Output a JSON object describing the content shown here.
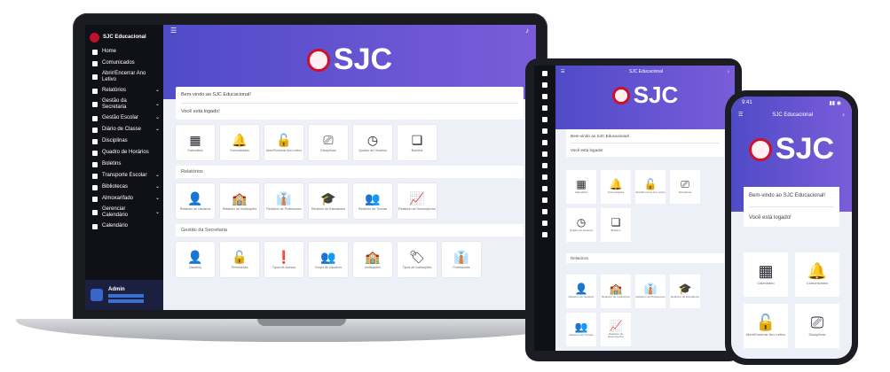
{
  "app": {
    "brand": "SJC Educacional",
    "logo_text": "SJC"
  },
  "sidebar": {
    "items": [
      {
        "label": "Home",
        "icon": "home-icon"
      },
      {
        "label": "Comunicados",
        "icon": "megaphone-icon"
      },
      {
        "label": "Abrir/Encerrar Ano Letivo",
        "icon": "calendar-lock-icon"
      },
      {
        "label": "Relatórios",
        "icon": "chart-icon",
        "chevron": "⌄"
      },
      {
        "label": "Gestão da Secretaria",
        "icon": "briefcase-icon",
        "chevron": "⌄"
      },
      {
        "label": "Gestão Escolar",
        "icon": "school-icon",
        "chevron": "⌄"
      },
      {
        "label": "Diário de Classe",
        "icon": "book-icon",
        "chevron": "⌄"
      },
      {
        "label": "Disciplinas",
        "icon": "leaf-icon"
      },
      {
        "label": "Quadro de Horários",
        "icon": "clock-icon"
      },
      {
        "label": "Boletins",
        "icon": "doc-icon"
      },
      {
        "label": "Transporte Escolar",
        "icon": "bus-icon",
        "chevron": "⌄"
      },
      {
        "label": "Bibliotecas",
        "icon": "library-icon",
        "chevron": "⌄"
      },
      {
        "label": "Almoxarifado",
        "icon": "box-icon",
        "chevron": "⌄"
      },
      {
        "label": "Gerenciar Calendário",
        "icon": "calendar-icon",
        "chevron": "⌄"
      },
      {
        "label": "Calendário",
        "icon": "calendar-icon"
      }
    ],
    "user": {
      "name": "Admin"
    }
  },
  "main": {
    "welcome": "Bem-vindo ao SJC Educacional!",
    "logged": "Você está logado!",
    "quick_tiles": [
      {
        "glyph": "▦",
        "label": "Calendário",
        "icon": "calendar-icon"
      },
      {
        "glyph": "🔔",
        "label": "Comunicados",
        "icon": "bell-icon"
      },
      {
        "glyph": "🔓",
        "label": "Abrir/Encerrar Ano Letivo",
        "icon": "unlock-icon"
      },
      {
        "glyph": "⎚",
        "label": "Disciplinas",
        "icon": "teacher-board-icon"
      },
      {
        "glyph": "◷",
        "label": "Quadro de Horários",
        "icon": "clock-icon"
      },
      {
        "glyph": "❏",
        "label": "Boletins",
        "icon": "scroll-icon"
      }
    ],
    "reports_title": "Relatórios",
    "report_tiles": [
      {
        "glyph": "👤",
        "label": "Relatório de Usuários",
        "icon": "user-icon"
      },
      {
        "glyph": "🏫",
        "label": "Relatório de Instituições",
        "icon": "school-icon"
      },
      {
        "glyph": "👔",
        "label": "Relatório de Professores",
        "icon": "teacher-icon"
      },
      {
        "glyph": "🎓",
        "label": "Relatório de Estudantes",
        "icon": "graduate-icon"
      },
      {
        "glyph": "👥",
        "label": "Relatório de Turmas",
        "icon": "group-icon"
      },
      {
        "glyph": "📈",
        "label": "Relatório de Desempenho",
        "icon": "trend-icon"
      }
    ],
    "secretaria_title": "Gestão da Secretaria",
    "secretaria_tiles": [
      {
        "glyph": "👤",
        "label": "Usuários",
        "icon": "user-icon"
      },
      {
        "glyph": "🔓",
        "label": "Permissões",
        "icon": "unlock-icon"
      },
      {
        "glyph": "❗",
        "label": "Tipos de Acesso",
        "icon": "alert-icon"
      },
      {
        "glyph": "👥",
        "label": "Grupo de Usuários",
        "icon": "group-icon"
      },
      {
        "glyph": "🏫",
        "label": "Instituições",
        "icon": "school-icon"
      },
      {
        "glyph": "🏷",
        "label": "Tipos de Instituições",
        "icon": "tags-icon"
      },
      {
        "glyph": "👔",
        "label": "Professores",
        "icon": "teacher-icon"
      }
    ]
  },
  "phone": {
    "time": "9:41",
    "title": "SJC Educacional"
  }
}
